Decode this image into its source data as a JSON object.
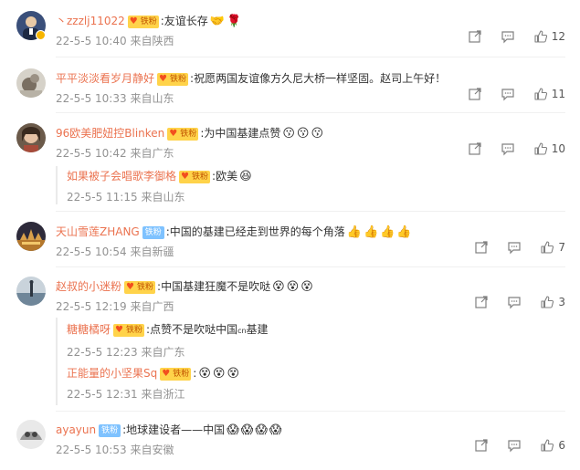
{
  "comments": [
    {
      "user": "丶zzzlj11022",
      "badge": "铁粉",
      "badge_style": "gold",
      "text": ":友谊长存",
      "emojis": [
        "🤝",
        "🌹"
      ],
      "time": "22-5-5 10:40",
      "location": "来自陕西",
      "likes": "12",
      "verified": true
    },
    {
      "user": "平平淡淡看岁月静好",
      "badge": "铁粉",
      "badge_style": "gold",
      "text": ":祝愿两国友谊像方久尼大桥一样坚固。赵司上午好！",
      "emojis": [],
      "time": "22-5-5 10:33",
      "location": "来自山东",
      "likes": "11"
    },
    {
      "user": "96欧美肥妞控Blinken",
      "badge": "铁粉",
      "badge_style": "gold",
      "text": ":为中国基建点赞",
      "emojis": [
        "😗",
        "😗",
        "😗"
      ],
      "time": "22-5-5 10:42",
      "location": "来自广东",
      "likes": "10",
      "replies": [
        {
          "user": "如果被子会唱歌李御格",
          "badge": "铁粉",
          "text": ":欧美",
          "emojis": [
            "😆"
          ],
          "time": "22-5-5 11:15",
          "location": "来自山东"
        }
      ]
    },
    {
      "user": "天山雪莲ZHANG",
      "badge": "铁粉",
      "badge_style": "blue",
      "text": ":中国的基建已经走到世界的每个角落",
      "emojis": [
        "👍",
        "👍",
        "👍",
        "👍"
      ],
      "time": "22-5-5 10:54",
      "location": "来自新疆",
      "likes": "7"
    },
    {
      "user": "赵叔的小迷粉",
      "badge": "铁粉",
      "badge_style": "gold",
      "text": ":中国基建狂魔不是吹哒",
      "emojis": [
        "😵",
        "😵",
        "😵"
      ],
      "time": "22-5-5 12:19",
      "location": "来自广西",
      "likes": "3",
      "replies": [
        {
          "user": "糖糖橘呀",
          "badge": "铁粉",
          "text": ":点赞不是吹哒中国",
          "extra": "cn",
          "text2": "基建",
          "emojis": [],
          "time": "22-5-5 12:23",
          "location": "来自广东"
        },
        {
          "user": "正能量的小坚果Sq",
          "badge": "铁粉",
          "text": ":",
          "emojis": [
            "😵",
            "😵",
            "😵"
          ],
          "time": "22-5-5 12:31",
          "location": "来自浙江"
        }
      ]
    },
    {
      "user": "ayayun",
      "badge": "铁粉",
      "badge_style": "blue",
      "text": ":地球建设者——中国",
      "emojis": [
        "😱",
        "😱",
        "😱",
        "😱"
      ],
      "time": "22-5-5 10:53",
      "location": "来自安徽",
      "likes": "6"
    }
  ],
  "colors": {
    "username": "#eb7350",
    "meta": "#939393",
    "badge_gold": "#ffd34a",
    "badge_blue": "#7ec2ff"
  }
}
